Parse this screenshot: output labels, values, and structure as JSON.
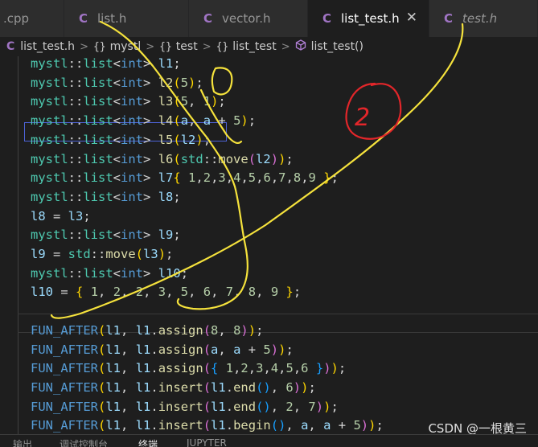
{
  "tabs": [
    {
      "label": ".cpp",
      "icon": "c-file-icon",
      "icon_text": "",
      "active": false,
      "italic": false
    },
    {
      "label": "list.h",
      "icon": "c-file-icon",
      "icon_text": "C",
      "active": false,
      "italic": false
    },
    {
      "label": "vector.h",
      "icon": "c-file-icon",
      "icon_text": "C",
      "active": false,
      "italic": false
    },
    {
      "label": "list_test.h",
      "icon": "c-file-icon",
      "icon_text": "C",
      "active": true,
      "italic": false
    },
    {
      "label": "test.h",
      "icon": "c-file-icon",
      "icon_text": "C",
      "active": false,
      "italic": true
    }
  ],
  "tab_close": "✕",
  "breadcrumb": {
    "file_icon": "C",
    "file": "list_test.h",
    "items": [
      "mystl",
      "test",
      "list_test"
    ],
    "ns_icon": "{}",
    "function": "list_test()"
  },
  "code": {
    "lines": [
      [
        [
          "tok-ns",
          "mystl"
        ],
        [
          "tok-p",
          "::"
        ],
        [
          "tok-ns",
          "list"
        ],
        [
          "tok-p",
          "<"
        ],
        [
          "tok-kw",
          "int"
        ],
        [
          "tok-p",
          "> "
        ],
        [
          "tok-var",
          "l1"
        ],
        [
          "tok-p",
          ";"
        ]
      ],
      [
        [
          "tok-ns",
          "mystl"
        ],
        [
          "tok-p",
          "::"
        ],
        [
          "tok-ns",
          "list"
        ],
        [
          "tok-p",
          "<"
        ],
        [
          "tok-kw",
          "int"
        ],
        [
          "tok-p",
          "> "
        ],
        [
          "tok-fn",
          "l2"
        ],
        [
          "tok-b1",
          "("
        ],
        [
          "tok-num",
          "5"
        ],
        [
          "tok-b1",
          ")"
        ],
        [
          "tok-p",
          ";"
        ]
      ],
      [
        [
          "tok-ns",
          "mystl"
        ],
        [
          "tok-p",
          "::"
        ],
        [
          "tok-ns",
          "list"
        ],
        [
          "tok-p",
          "<"
        ],
        [
          "tok-kw",
          "int"
        ],
        [
          "tok-p",
          "> "
        ],
        [
          "tok-fn",
          "l3"
        ],
        [
          "tok-b1",
          "("
        ],
        [
          "tok-num",
          "5"
        ],
        [
          "tok-p",
          ", "
        ],
        [
          "tok-num",
          "1"
        ],
        [
          "tok-b1",
          ")"
        ],
        [
          "tok-p",
          ";"
        ]
      ],
      [
        [
          "tok-ns",
          "mystl"
        ],
        [
          "tok-p",
          "::"
        ],
        [
          "tok-ns",
          "list"
        ],
        [
          "tok-p",
          "<"
        ],
        [
          "tok-kw",
          "int"
        ],
        [
          "tok-p",
          "> "
        ],
        [
          "tok-fn",
          "l4"
        ],
        [
          "tok-b1",
          "("
        ],
        [
          "tok-var",
          "a"
        ],
        [
          "tok-p",
          ", "
        ],
        [
          "tok-var",
          "a"
        ],
        [
          "tok-p",
          " + "
        ],
        [
          "tok-num",
          "5"
        ],
        [
          "tok-b1",
          ")"
        ],
        [
          "tok-p",
          ";"
        ]
      ],
      [
        [
          "tok-ns",
          "mystl"
        ],
        [
          "tok-p",
          "::"
        ],
        [
          "tok-ns",
          "list"
        ],
        [
          "tok-p",
          "<"
        ],
        [
          "tok-kw",
          "int"
        ],
        [
          "tok-p",
          "> "
        ],
        [
          "tok-fn",
          "l5"
        ],
        [
          "tok-b1",
          "("
        ],
        [
          "tok-var",
          "l2"
        ],
        [
          "tok-b1",
          ")"
        ],
        [
          "tok-p",
          ";"
        ]
      ],
      [
        [
          "tok-ns",
          "mystl"
        ],
        [
          "tok-p",
          "::"
        ],
        [
          "tok-ns",
          "list"
        ],
        [
          "tok-p",
          "<"
        ],
        [
          "tok-kw",
          "int"
        ],
        [
          "tok-p",
          "> "
        ],
        [
          "tok-fn",
          "l6"
        ],
        [
          "tok-b1",
          "("
        ],
        [
          "tok-ns",
          "std"
        ],
        [
          "tok-p",
          "::"
        ],
        [
          "tok-fn",
          "move"
        ],
        [
          "tok-b2",
          "("
        ],
        [
          "tok-var",
          "l2"
        ],
        [
          "tok-b2",
          ")"
        ],
        [
          "tok-b1",
          ")"
        ],
        [
          "tok-p",
          ";"
        ]
      ],
      [
        [
          "tok-ns",
          "mystl"
        ],
        [
          "tok-p",
          "::"
        ],
        [
          "tok-ns",
          "list"
        ],
        [
          "tok-p",
          "<"
        ],
        [
          "tok-kw",
          "int"
        ],
        [
          "tok-p",
          "> "
        ],
        [
          "tok-var",
          "l7"
        ],
        [
          "tok-b1",
          "{"
        ],
        [
          "tok-p",
          " "
        ],
        [
          "tok-num",
          "1"
        ],
        [
          "tok-p",
          ","
        ],
        [
          "tok-num",
          "2"
        ],
        [
          "tok-p",
          ","
        ],
        [
          "tok-num",
          "3"
        ],
        [
          "tok-p",
          ","
        ],
        [
          "tok-num",
          "4"
        ],
        [
          "tok-p",
          ","
        ],
        [
          "tok-num",
          "5"
        ],
        [
          "tok-p",
          ","
        ],
        [
          "tok-num",
          "6"
        ],
        [
          "tok-p",
          ","
        ],
        [
          "tok-num",
          "7"
        ],
        [
          "tok-p",
          ","
        ],
        [
          "tok-num",
          "8"
        ],
        [
          "tok-p",
          ","
        ],
        [
          "tok-num",
          "9"
        ],
        [
          "tok-p",
          " "
        ],
        [
          "tok-b1",
          "}"
        ],
        [
          "tok-p",
          ";"
        ]
      ],
      [
        [
          "tok-ns",
          "mystl"
        ],
        [
          "tok-p",
          "::"
        ],
        [
          "tok-ns",
          "list"
        ],
        [
          "tok-p",
          "<"
        ],
        [
          "tok-kw",
          "int"
        ],
        [
          "tok-p",
          "> "
        ],
        [
          "tok-var",
          "l8"
        ],
        [
          "tok-p",
          ";"
        ]
      ],
      [
        [
          "tok-var",
          "l8"
        ],
        [
          "tok-p",
          " = "
        ],
        [
          "tok-var",
          "l3"
        ],
        [
          "tok-p",
          ";"
        ]
      ],
      [
        [
          "tok-ns",
          "mystl"
        ],
        [
          "tok-p",
          "::"
        ],
        [
          "tok-ns",
          "list"
        ],
        [
          "tok-p",
          "<"
        ],
        [
          "tok-kw",
          "int"
        ],
        [
          "tok-p",
          "> "
        ],
        [
          "tok-var",
          "l9"
        ],
        [
          "tok-p",
          ";"
        ]
      ],
      [
        [
          "tok-var",
          "l9"
        ],
        [
          "tok-p",
          " = "
        ],
        [
          "tok-ns",
          "std"
        ],
        [
          "tok-p",
          "::"
        ],
        [
          "tok-fn",
          "move"
        ],
        [
          "tok-b1",
          "("
        ],
        [
          "tok-var",
          "l3"
        ],
        [
          "tok-b1",
          ")"
        ],
        [
          "tok-p",
          ";"
        ]
      ],
      [
        [
          "tok-ns",
          "mystl"
        ],
        [
          "tok-p",
          "::"
        ],
        [
          "tok-ns",
          "list"
        ],
        [
          "tok-p",
          "<"
        ],
        [
          "tok-kw",
          "int"
        ],
        [
          "tok-p",
          "> "
        ],
        [
          "tok-var",
          "l10"
        ],
        [
          "tok-p",
          ";"
        ]
      ],
      [
        [
          "tok-var",
          "l10"
        ],
        [
          "tok-p",
          " = "
        ],
        [
          "tok-b1",
          "{"
        ],
        [
          "tok-p",
          " "
        ],
        [
          "tok-num",
          "1"
        ],
        [
          "tok-p",
          ", "
        ],
        [
          "tok-num",
          "2"
        ],
        [
          "tok-p",
          ", "
        ],
        [
          "tok-num",
          "2"
        ],
        [
          "tok-p",
          ", "
        ],
        [
          "tok-num",
          "3"
        ],
        [
          "tok-p",
          ", "
        ],
        [
          "tok-num",
          "5"
        ],
        [
          "tok-p",
          ", "
        ],
        [
          "tok-num",
          "6"
        ],
        [
          "tok-p",
          ", "
        ],
        [
          "tok-num",
          "7"
        ],
        [
          "tok-p",
          ", "
        ],
        [
          "tok-num",
          "8"
        ],
        [
          "tok-p",
          ", "
        ],
        [
          "tok-num",
          "9"
        ],
        [
          "tok-p",
          " "
        ],
        [
          "tok-b1",
          "}"
        ],
        [
          "tok-p",
          ";"
        ]
      ],
      [],
      [
        [
          "tok-macro",
          "FUN_AFTER"
        ],
        [
          "tok-b1",
          "("
        ],
        [
          "tok-var",
          "l1"
        ],
        [
          "tok-p",
          ", "
        ],
        [
          "tok-var",
          "l1"
        ],
        [
          "tok-p",
          "."
        ],
        [
          "tok-fn",
          "assign"
        ],
        [
          "tok-b2",
          "("
        ],
        [
          "tok-num",
          "8"
        ],
        [
          "tok-p",
          ", "
        ],
        [
          "tok-num",
          "8"
        ],
        [
          "tok-b2",
          ")"
        ],
        [
          "tok-b1",
          ")"
        ],
        [
          "tok-p",
          ";"
        ]
      ],
      [
        [
          "tok-macro",
          "FUN_AFTER"
        ],
        [
          "tok-b1",
          "("
        ],
        [
          "tok-var",
          "l1"
        ],
        [
          "tok-p",
          ", "
        ],
        [
          "tok-var",
          "l1"
        ],
        [
          "tok-p",
          "."
        ],
        [
          "tok-fn",
          "assign"
        ],
        [
          "tok-b2",
          "("
        ],
        [
          "tok-var",
          "a"
        ],
        [
          "tok-p",
          ", "
        ],
        [
          "tok-var",
          "a"
        ],
        [
          "tok-p",
          " + "
        ],
        [
          "tok-num",
          "5"
        ],
        [
          "tok-b2",
          ")"
        ],
        [
          "tok-b1",
          ")"
        ],
        [
          "tok-p",
          ";"
        ]
      ],
      [
        [
          "tok-macro",
          "FUN_AFTER"
        ],
        [
          "tok-b1",
          "("
        ],
        [
          "tok-var",
          "l1"
        ],
        [
          "tok-p",
          ", "
        ],
        [
          "tok-var",
          "l1"
        ],
        [
          "tok-p",
          "."
        ],
        [
          "tok-fn",
          "assign"
        ],
        [
          "tok-b2",
          "("
        ],
        [
          "tok-b3",
          "{"
        ],
        [
          "tok-p",
          " "
        ],
        [
          "tok-num",
          "1"
        ],
        [
          "tok-p",
          ","
        ],
        [
          "tok-num",
          "2"
        ],
        [
          "tok-p",
          ","
        ],
        [
          "tok-num",
          "3"
        ],
        [
          "tok-p",
          ","
        ],
        [
          "tok-num",
          "4"
        ],
        [
          "tok-p",
          ","
        ],
        [
          "tok-num",
          "5"
        ],
        [
          "tok-p",
          ","
        ],
        [
          "tok-num",
          "6"
        ],
        [
          "tok-p",
          " "
        ],
        [
          "tok-b3",
          "}"
        ],
        [
          "tok-b2",
          ")"
        ],
        [
          "tok-b1",
          ")"
        ],
        [
          "tok-p",
          ";"
        ]
      ],
      [
        [
          "tok-macro",
          "FUN_AFTER"
        ],
        [
          "tok-b1",
          "("
        ],
        [
          "tok-var",
          "l1"
        ],
        [
          "tok-p",
          ", "
        ],
        [
          "tok-var",
          "l1"
        ],
        [
          "tok-p",
          "."
        ],
        [
          "tok-fn",
          "insert"
        ],
        [
          "tok-b2",
          "("
        ],
        [
          "tok-var",
          "l1"
        ],
        [
          "tok-p",
          "."
        ],
        [
          "tok-fn",
          "end"
        ],
        [
          "tok-b3",
          "()"
        ],
        [
          "tok-p",
          ", "
        ],
        [
          "tok-num",
          "6"
        ],
        [
          "tok-b2",
          ")"
        ],
        [
          "tok-b1",
          ")"
        ],
        [
          "tok-p",
          ";"
        ]
      ],
      [
        [
          "tok-macro",
          "FUN_AFTER"
        ],
        [
          "tok-b1",
          "("
        ],
        [
          "tok-var",
          "l1"
        ],
        [
          "tok-p",
          ", "
        ],
        [
          "tok-var",
          "l1"
        ],
        [
          "tok-p",
          "."
        ],
        [
          "tok-fn",
          "insert"
        ],
        [
          "tok-b2",
          "("
        ],
        [
          "tok-var",
          "l1"
        ],
        [
          "tok-p",
          "."
        ],
        [
          "tok-fn",
          "end"
        ],
        [
          "tok-b3",
          "()"
        ],
        [
          "tok-p",
          ", "
        ],
        [
          "tok-num",
          "2"
        ],
        [
          "tok-p",
          ", "
        ],
        [
          "tok-num",
          "7"
        ],
        [
          "tok-b2",
          ")"
        ],
        [
          "tok-b1",
          ")"
        ],
        [
          "tok-p",
          ";"
        ]
      ],
      [
        [
          "tok-macro",
          "FUN_AFTER"
        ],
        [
          "tok-b1",
          "("
        ],
        [
          "tok-var",
          "l1"
        ],
        [
          "tok-p",
          ", "
        ],
        [
          "tok-var",
          "l1"
        ],
        [
          "tok-p",
          "."
        ],
        [
          "tok-fn",
          "insert"
        ],
        [
          "tok-b2",
          "("
        ],
        [
          "tok-var",
          "l1"
        ],
        [
          "tok-p",
          "."
        ],
        [
          "tok-fn",
          "begin"
        ],
        [
          "tok-b3",
          "()"
        ],
        [
          "tok-p",
          ", "
        ],
        [
          "tok-var",
          "a"
        ],
        [
          "tok-p",
          ", "
        ],
        [
          "tok-var",
          "a"
        ],
        [
          "tok-p",
          " + "
        ],
        [
          "tok-num",
          "5"
        ],
        [
          "tok-b2",
          ")"
        ],
        [
          "tok-b1",
          ")"
        ],
        [
          "tok-p",
          ";"
        ]
      ]
    ]
  },
  "panel_tabs": [
    {
      "label": "输出",
      "active": false
    },
    {
      "label": "调试控制台",
      "active": false
    },
    {
      "label": "终端",
      "active": true
    },
    {
      "label": "JUPYTER",
      "active": false
    }
  ],
  "watermark": "CSDN @一根黄三",
  "annotation_text": "2",
  "colors": {
    "annotation_yellow": "#f5e23c",
    "annotation_red": "#e3262a",
    "selection_box": "#4d62d6"
  }
}
